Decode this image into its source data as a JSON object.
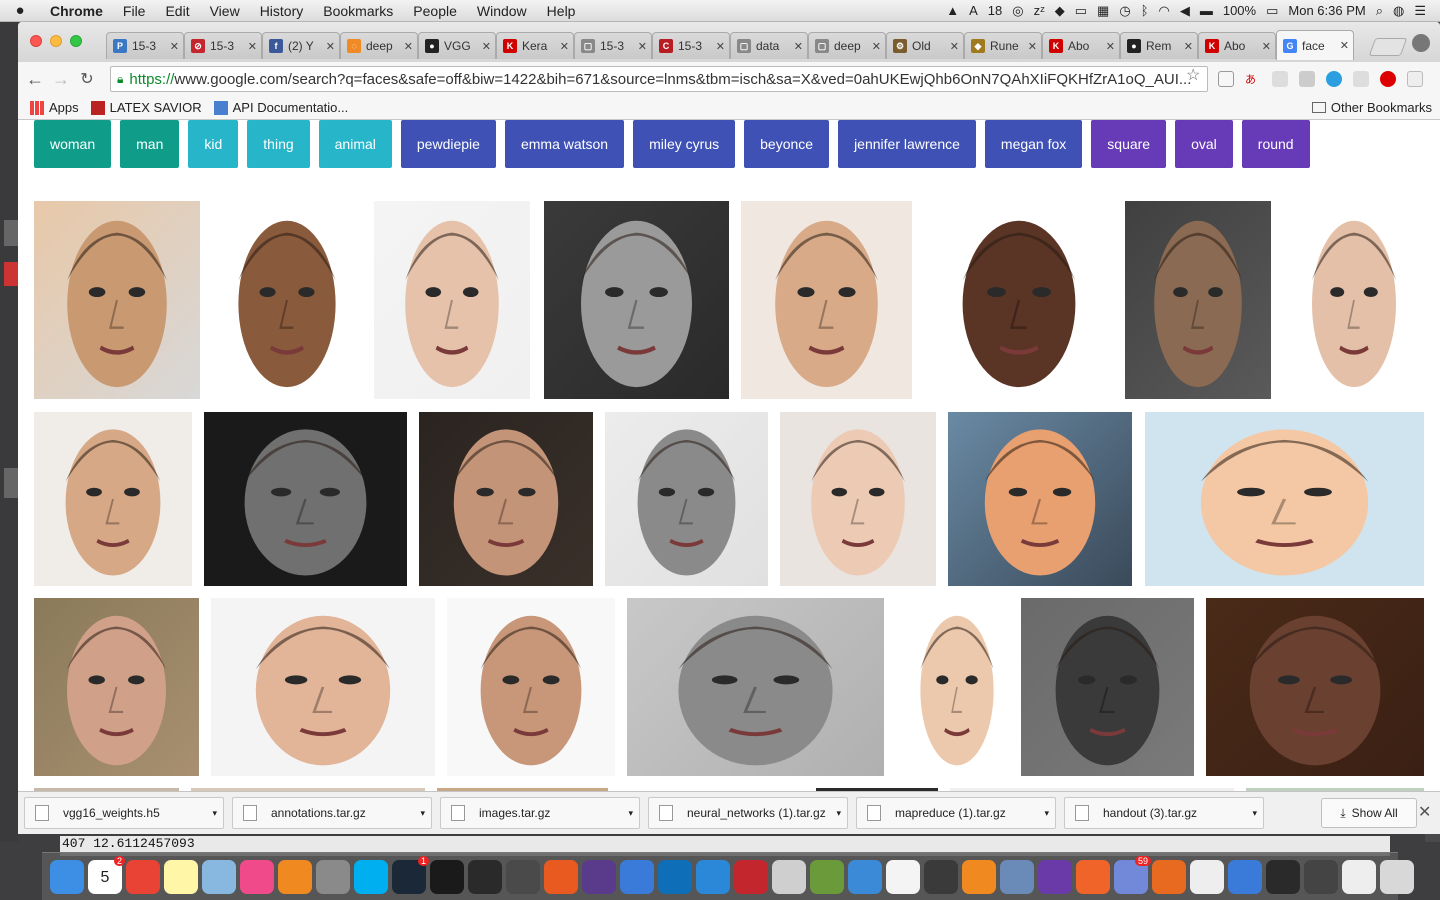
{
  "menubar": {
    "app": "Chrome",
    "items": [
      "File",
      "Edit",
      "View",
      "History",
      "Bookmarks",
      "People",
      "Window",
      "Help"
    ],
    "tray_count": "18",
    "battery": "100%",
    "clock": "Mon 6:36 PM"
  },
  "tabs": [
    {
      "title": "15-3",
      "color": "#3b78c3",
      "glyph": "P"
    },
    {
      "title": "15-3",
      "color": "#c4262e",
      "glyph": "⊘"
    },
    {
      "title": "(2) Y",
      "color": "#3b5998",
      "glyph": "f"
    },
    {
      "title": "deep",
      "color": "#f08a24",
      "glyph": "◌"
    },
    {
      "title": "VGG",
      "color": "#222222",
      "glyph": "●"
    },
    {
      "title": "Kera",
      "color": "#d00000",
      "glyph": "K"
    },
    {
      "title": "15-3",
      "color": "#888888",
      "glyph": "▢"
    },
    {
      "title": "15-3",
      "color": "#b81d24",
      "glyph": "C"
    },
    {
      "title": "data",
      "color": "#888888",
      "glyph": "▢"
    },
    {
      "title": "deep",
      "color": "#888888",
      "glyph": "▢"
    },
    {
      "title": "Old",
      "color": "#7a5c2e",
      "glyph": "⚙"
    },
    {
      "title": "Rune",
      "color": "#a07a1e",
      "glyph": "◆"
    },
    {
      "title": "Abo",
      "color": "#d00000",
      "glyph": "K"
    },
    {
      "title": "Rem",
      "color": "#222222",
      "glyph": "●"
    },
    {
      "title": "Abo",
      "color": "#d00000",
      "glyph": "K"
    },
    {
      "title": "face",
      "color": "#4285f4",
      "glyph": "G"
    }
  ],
  "toolbar": {
    "url_scheme": "https://",
    "url_rest": "www.google.com/search?q=faces&safe=off&biw=1422&bih=671&source=lnms&tbm=isch&sa=X&ved=0ahUKEwjQhb6OnN7QAhXIiFQKHfZrA1oQ_AUI..."
  },
  "bookmarks": {
    "apps": "Apps",
    "items": [
      "LATEX SAVIOR",
      "API Documentatio..."
    ],
    "other": "Other Bookmarks"
  },
  "chips": [
    {
      "label": "woman",
      "color": "#0f9d8a"
    },
    {
      "label": "man",
      "color": "#0f9d8a"
    },
    {
      "label": "kid",
      "color": "#26b5c9"
    },
    {
      "label": "thing",
      "color": "#26b5c9"
    },
    {
      "label": "animal",
      "color": "#26b5c9"
    },
    {
      "label": "pewdiepie",
      "color": "#3f51b5"
    },
    {
      "label": "emma watson",
      "color": "#3f51b5"
    },
    {
      "label": "miley cyrus",
      "color": "#3f51b5"
    },
    {
      "label": "beyonce",
      "color": "#3f51b5"
    },
    {
      "label": "jennifer lawrence",
      "color": "#3f51b5"
    },
    {
      "label": "megan fox",
      "color": "#3f51b5"
    },
    {
      "label": "square",
      "color": "#673ab7"
    },
    {
      "label": "oval",
      "color": "#673ab7"
    },
    {
      "label": "round",
      "color": "#673ab7"
    }
  ],
  "downloads": {
    "files": [
      "vgg16_weights.h5",
      "annotations.tar.gz",
      "images.tar.gz",
      "neural_networks (1).tar.gz",
      "mapreduce (1).tar.gz",
      "handout (3).tar.gz"
    ],
    "show_all": "Show All"
  },
  "terminal": {
    "text": "407 12.6112457093"
  },
  "dock": {
    "calendar_day": "5",
    "badges": {
      "calendar": "2",
      "steam": "1",
      "discord": "59"
    }
  }
}
